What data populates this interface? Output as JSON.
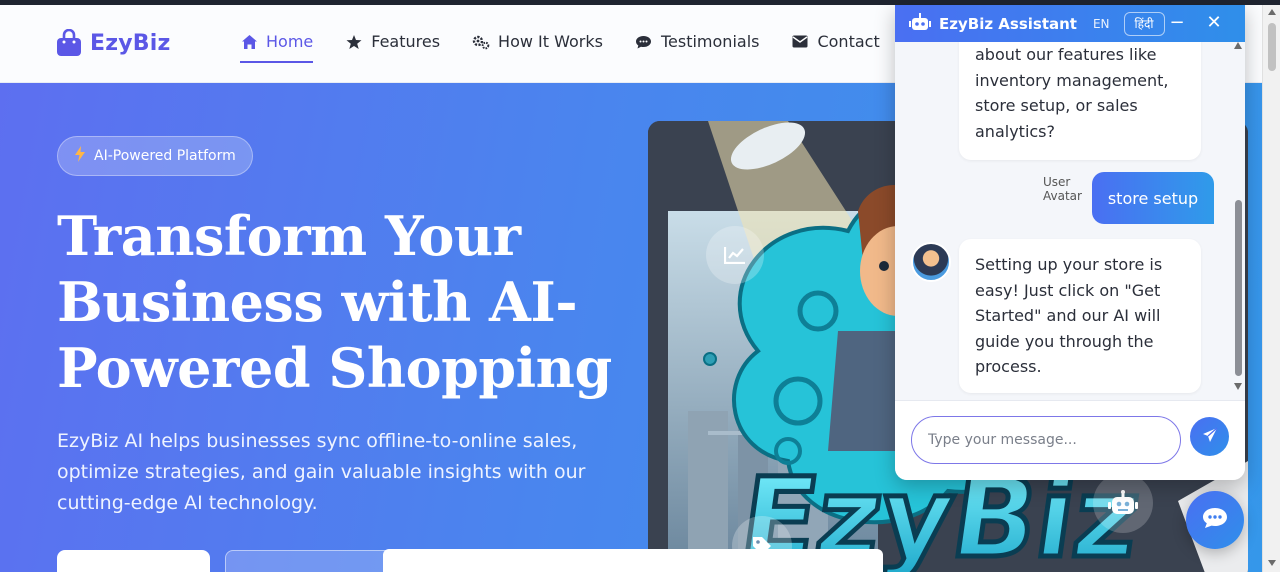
{
  "brand": {
    "name": "EzyBiz",
    "icon": "shopping-bag-icon",
    "color": "#5b57e6"
  },
  "nav": {
    "items": [
      {
        "label": "Home",
        "icon": "home-icon",
        "active": true
      },
      {
        "label": "Features",
        "icon": "star-icon",
        "active": false
      },
      {
        "label": "How It Works",
        "icon": "cogs-icon",
        "active": false
      },
      {
        "label": "Testimonials",
        "icon": "comment-icon",
        "active": false
      },
      {
        "label": "Contact",
        "icon": "envelope-icon",
        "active": false
      }
    ]
  },
  "hero": {
    "badge": "AI-Powered Platform",
    "badge_icon": "bolt-icon",
    "title": "Transform Your Business with AI-Powered Shopping",
    "description": "EzyBiz AI helps businesses sync offline-to-online sales, optimize strategies, and gain valuable insights with our cutting-edge AI technology.",
    "art_text": "EzyBiz",
    "gradient": [
      "#5d6ff0",
      "#3597ea"
    ]
  },
  "chat": {
    "title": "EzyBiz Assistant",
    "lang_en": "EN",
    "lang_hi": "हिंदी",
    "minimize": "−",
    "close": "✕",
    "messages": [
      {
        "from": "bot",
        "text": "about our features like inventory management, store setup, or sales analytics?"
      },
      {
        "from": "user",
        "text": "store setup",
        "avatar_alt": "User Avatar"
      },
      {
        "from": "bot",
        "text": "Setting up your store is easy! Just click on \"Get Started\" and our AI will guide you through the process."
      }
    ],
    "input_placeholder": "Type your message...",
    "accent": "#4a6ff2"
  }
}
